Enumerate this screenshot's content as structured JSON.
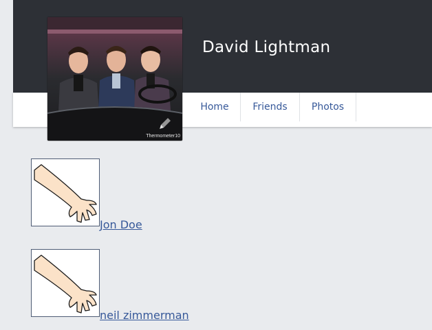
{
  "profile": {
    "name": "David Lightman",
    "cover_watermark": "Thermometer10",
    "edit_icon": "pencil-icon"
  },
  "nav": {
    "tabs": [
      {
        "label": "Home"
      },
      {
        "label": "Friends"
      },
      {
        "label": "Photos"
      }
    ]
  },
  "friends": [
    {
      "name": "Jon Doe",
      "avatar_icon": "arm-icon"
    },
    {
      "name": "neil zimmerman",
      "avatar_icon": "arm-icon"
    }
  ],
  "colors": {
    "header_bg": "#2d3036",
    "page_bg": "#e9ebee",
    "link": "#365899"
  }
}
